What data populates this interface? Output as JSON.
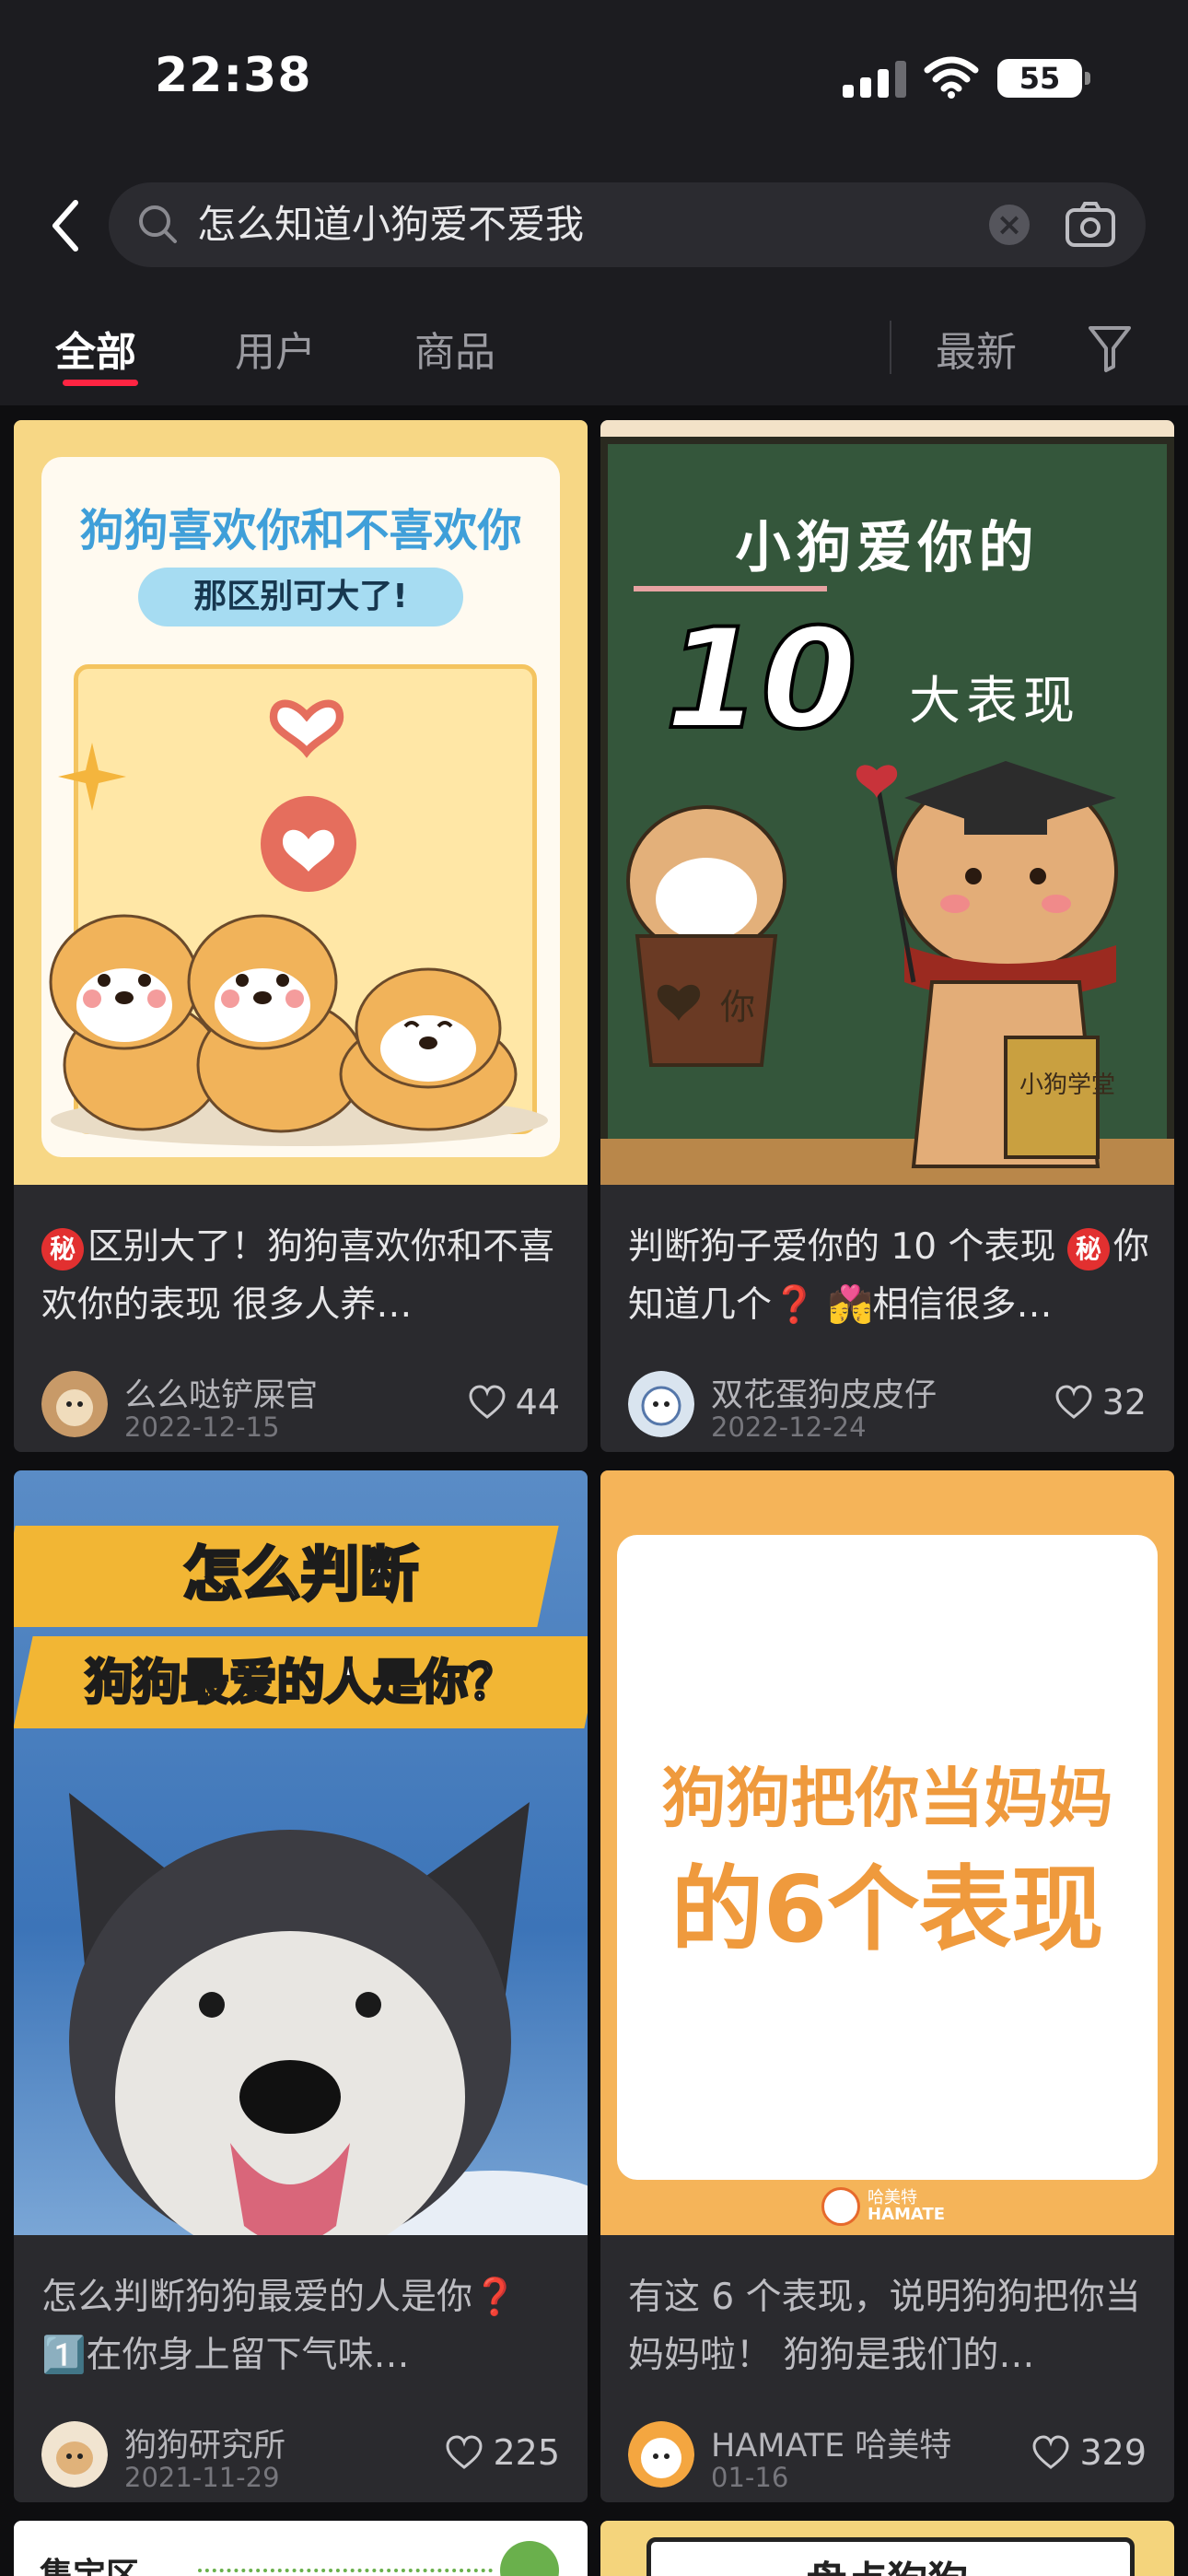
{
  "status": {
    "time": "22:38",
    "battery": "55"
  },
  "search": {
    "query": "怎么知道小狗爱不爱我"
  },
  "tabs": [
    {
      "label": "全部",
      "active": true
    },
    {
      "label": "用户",
      "active": false
    },
    {
      "label": "商品",
      "active": false
    }
  ],
  "sort_label": "最新",
  "cards": [
    {
      "cover": {
        "title": "狗狗喜欢你和不喜欢你",
        "subtitle": "那区别可大了!"
      },
      "badge": "秘",
      "desc": "区别大了！狗狗喜欢你和不喜欢你的表现 很多人养…",
      "author": "么么哒铲屎官",
      "date": "2022-12-15",
      "likes": "44"
    },
    {
      "cover": {
        "title": "小狗爱你的",
        "number": "10",
        "suffix": "大表现",
        "cup_text": "你",
        "book_text": "小狗学堂"
      },
      "badge": "秘",
      "desc": "判断狗子爱你的 10 个表现 ",
      "desc2": "你知道几个❓ 💏相信很多…",
      "author": "双花蛋狗皮皮仔",
      "date": "2022-12-24",
      "likes": "32"
    },
    {
      "cover": {
        "line1": "怎么判断",
        "line2": "狗狗最爱的人是你？"
      },
      "desc": "怎么判断狗狗最爱的人是你❓ 1️⃣在你身上留下气味…",
      "author": "狗狗研究所",
      "date": "2021-11-29",
      "likes": "225"
    },
    {
      "cover": {
        "line1": "狗狗把你当妈妈",
        "line2": "的6个表现",
        "brand": "HAMATE",
        "brand_cn": "哈美特"
      },
      "desc": "有这 6 个表现，说明狗狗把你当妈妈啦！ 狗狗是我们的…",
      "author": "HAMATE 哈美特",
      "date": "01-16",
      "likes": "329"
    },
    {
      "cover": {
        "label": "集宝区"
      }
    },
    {
      "cover": {
        "label": "盘点狗狗"
      }
    }
  ],
  "colors": {
    "accent": "#ff2442",
    "bg": "#1c1c20",
    "card": "#2a2a2e"
  }
}
